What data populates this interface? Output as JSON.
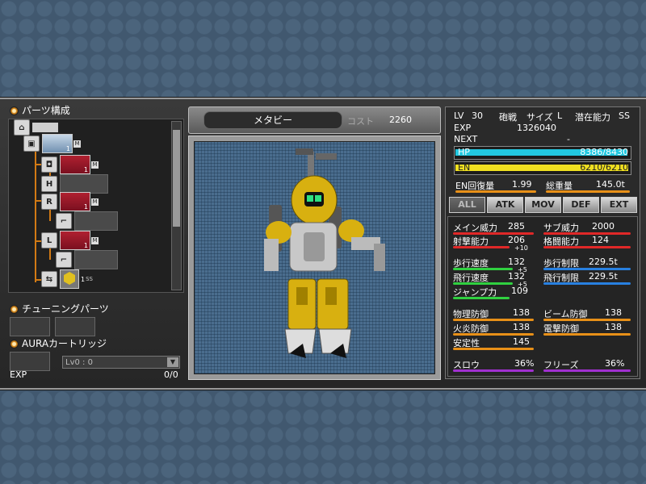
{
  "left": {
    "parts_title": "パーツ構成",
    "tuning_title": "チューニングパーツ",
    "aura_title": "AURAカートリッジ",
    "aura_select": "Lv0 : 0",
    "exp_label": "EXP",
    "exp_value": "0/0",
    "tree_lv": [
      "1",
      "1",
      "1",
      "1",
      "1"
    ],
    "tree_badge": "M",
    "tree_badge2": "SS"
  },
  "center": {
    "name": "メタビー",
    "cost_label": "コスト",
    "cost_value": "2260"
  },
  "stats": {
    "lv_label": "LV",
    "lv_value": "30",
    "class": "砲戦",
    "size_label": "サイズ",
    "size_value": "L",
    "potential_label": "潜在能力",
    "potential_value": "SS",
    "exp_label": "EXP",
    "exp_value": "1326040",
    "next_label": "NEXT",
    "next_value": "-",
    "hp_label": "HP",
    "hp_value": "8386/8430",
    "hp_fraction": 0.995,
    "en_label": "EN",
    "en_value": "6210/6210",
    "en_fraction": 1.0,
    "en_recovery_label": "EN回復量",
    "en_recovery_value": "1.99",
    "total_weight_label": "総重量",
    "total_weight_value": "145.0t",
    "tabs": [
      "ALL",
      "ATK",
      "MOV",
      "DEF",
      "EXT"
    ],
    "items": {
      "main_power_label": "メイン威力",
      "main_power": "285",
      "sub_power_label": "サブ威力",
      "sub_power": "2000",
      "shoot_label": "射撃能力",
      "shoot": "206",
      "shoot_bonus": "+10",
      "melee_label": "格闘能力",
      "melee": "124",
      "walk_speed_label": "歩行速度",
      "walk_speed": "132",
      "walk_bonus": "+5",
      "walk_limit_label": "歩行制限",
      "walk_limit": "229.5t",
      "fly_speed_label": "飛行速度",
      "fly_speed": "132",
      "fly_bonus": "+5",
      "fly_limit_label": "飛行制限",
      "fly_limit": "229.5t",
      "jump_label": "ジャンプ力",
      "jump": "109",
      "phys_def_label": "物理防御",
      "phys_def": "138",
      "beam_def_label": "ビーム防御",
      "beam_def": "138",
      "fire_def_label": "火炎防御",
      "fire_def": "138",
      "elec_def_label": "電撃防御",
      "elec_def": "138",
      "stability_label": "安定性",
      "stability": "145",
      "slow_label": "スロウ",
      "slow": "36%",
      "freeze_label": "フリーズ",
      "freeze": "36%"
    }
  },
  "colors": {
    "hp": "#22c8e0",
    "en": "#f0e020",
    "red": "#e02828",
    "green": "#30d040",
    "blue": "#2880e0",
    "orange": "#e89018",
    "purple": "#a030d0",
    "panel_bg": "#262626"
  }
}
